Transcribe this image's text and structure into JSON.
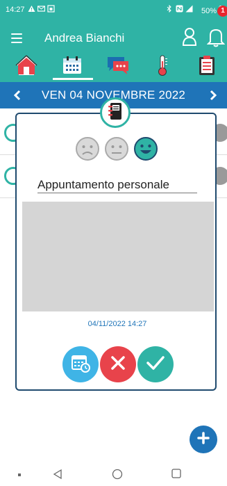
{
  "status_bar": {
    "time": "14:27",
    "battery": "50%",
    "left_icons": [
      "warning-icon",
      "mail-icon",
      "lock-icon"
    ],
    "right_icons": [
      "bluetooth-icon",
      "nfc-icon",
      "signal-icon",
      "battery-icon"
    ]
  },
  "header": {
    "user_name": "Andrea Bianchi",
    "notification_count": "1",
    "accent_color": "#2fb3a5"
  },
  "tabs": [
    {
      "icon": "home-icon"
    },
    {
      "icon": "calendar-icon",
      "active": true
    },
    {
      "icon": "chat-icon"
    },
    {
      "icon": "thermometer-icon"
    },
    {
      "icon": "clipboard-icon"
    }
  ],
  "date_bar": {
    "date": "VEN 04 NOVEMBRE 2022",
    "color": "#1f74b8"
  },
  "modal": {
    "badge_icon": "diary-icon",
    "moods": [
      "sad-face-icon",
      "neutral-face-icon",
      "happy-face-icon"
    ],
    "selected_mood": "happy-face-icon",
    "title": "Appuntamento personale",
    "timestamp": "04/11/2022 14:27",
    "buttons": [
      {
        "icon": "calendar-clock-icon",
        "color": "#3fb4e6"
      },
      {
        "icon": "close-icon",
        "color": "#e8434b"
      },
      {
        "icon": "check-icon",
        "color": "#2fb3a5"
      }
    ]
  },
  "fab": {
    "icon": "plus-icon"
  },
  "nav_bar": [
    "menu-dot-icon",
    "back-icon",
    "home-circle-icon",
    "recents-icon"
  ]
}
